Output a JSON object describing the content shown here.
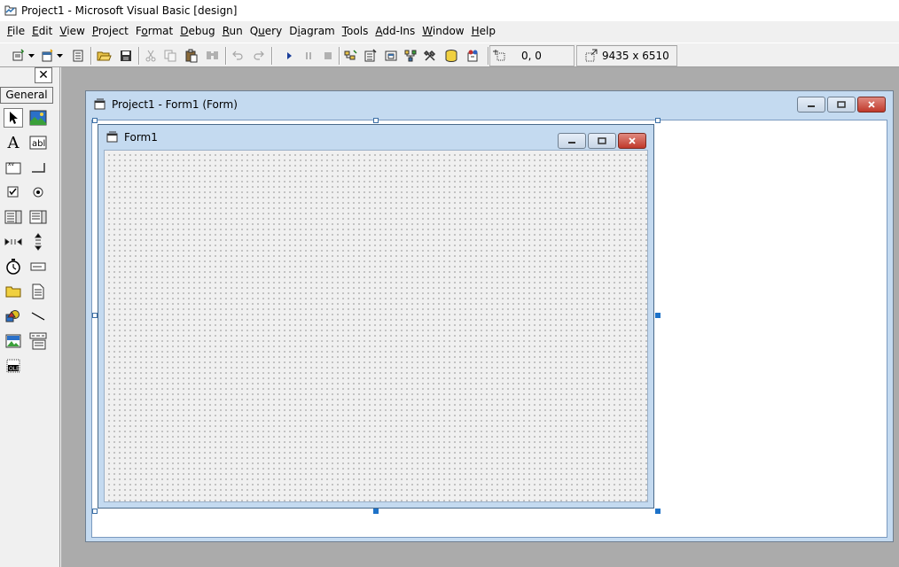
{
  "window": {
    "title": "Project1 - Microsoft Visual Basic [design]",
    "app_icon": "vb-project-icon"
  },
  "menu": [
    {
      "pre": "",
      "acc": "F",
      "post": "ile"
    },
    {
      "pre": "",
      "acc": "E",
      "post": "dit"
    },
    {
      "pre": "",
      "acc": "V",
      "post": "iew"
    },
    {
      "pre": "",
      "acc": "P",
      "post": "roject"
    },
    {
      "pre": "F",
      "acc": "o",
      "post": "rmat"
    },
    {
      "pre": "",
      "acc": "D",
      "post": "ebug"
    },
    {
      "pre": "",
      "acc": "R",
      "post": "un"
    },
    {
      "pre": "Q",
      "acc": "u",
      "post": "ery"
    },
    {
      "pre": "D",
      "acc": "i",
      "post": "agram"
    },
    {
      "pre": "",
      "acc": "T",
      "post": "ools"
    },
    {
      "pre": "",
      "acc": "A",
      "post": "dd-Ins"
    },
    {
      "pre": "",
      "acc": "W",
      "post": "indow"
    },
    {
      "pre": "",
      "acc": "H",
      "post": "elp"
    }
  ],
  "toolbar": {
    "position_readout": "0, 0",
    "size_readout": "9435 x 6510",
    "buttons": [
      "add-project-icon",
      "add-form-icon",
      "menu-editor-icon",
      "open-project-icon",
      "save-project-icon",
      "cut-icon",
      "copy-icon",
      "paste-icon",
      "find-icon",
      "undo-icon",
      "redo-icon",
      "start-icon",
      "break-icon",
      "end-icon",
      "project-explorer-icon",
      "properties-window-icon",
      "form-layout-icon",
      "object-browser-icon",
      "toolbox-icon",
      "data-view-icon",
      "component-manager-icon"
    ]
  },
  "toolbox": {
    "close_label": "✕",
    "tab_label": "General",
    "tools": [
      "pointer",
      "picturebox",
      "label",
      "textbox",
      "frame",
      "commandbutton",
      "checkbox",
      "optionbutton",
      "combobox",
      "listbox",
      "hscrollbar",
      "vscrollbar",
      "timer",
      "drivelistbox",
      "dirlistbox",
      "filelistbox",
      "shape",
      "line",
      "image",
      "data",
      "ole"
    ]
  },
  "designer": {
    "title": "Project1 - Form1 (Form)"
  },
  "form": {
    "caption": "Form1"
  }
}
